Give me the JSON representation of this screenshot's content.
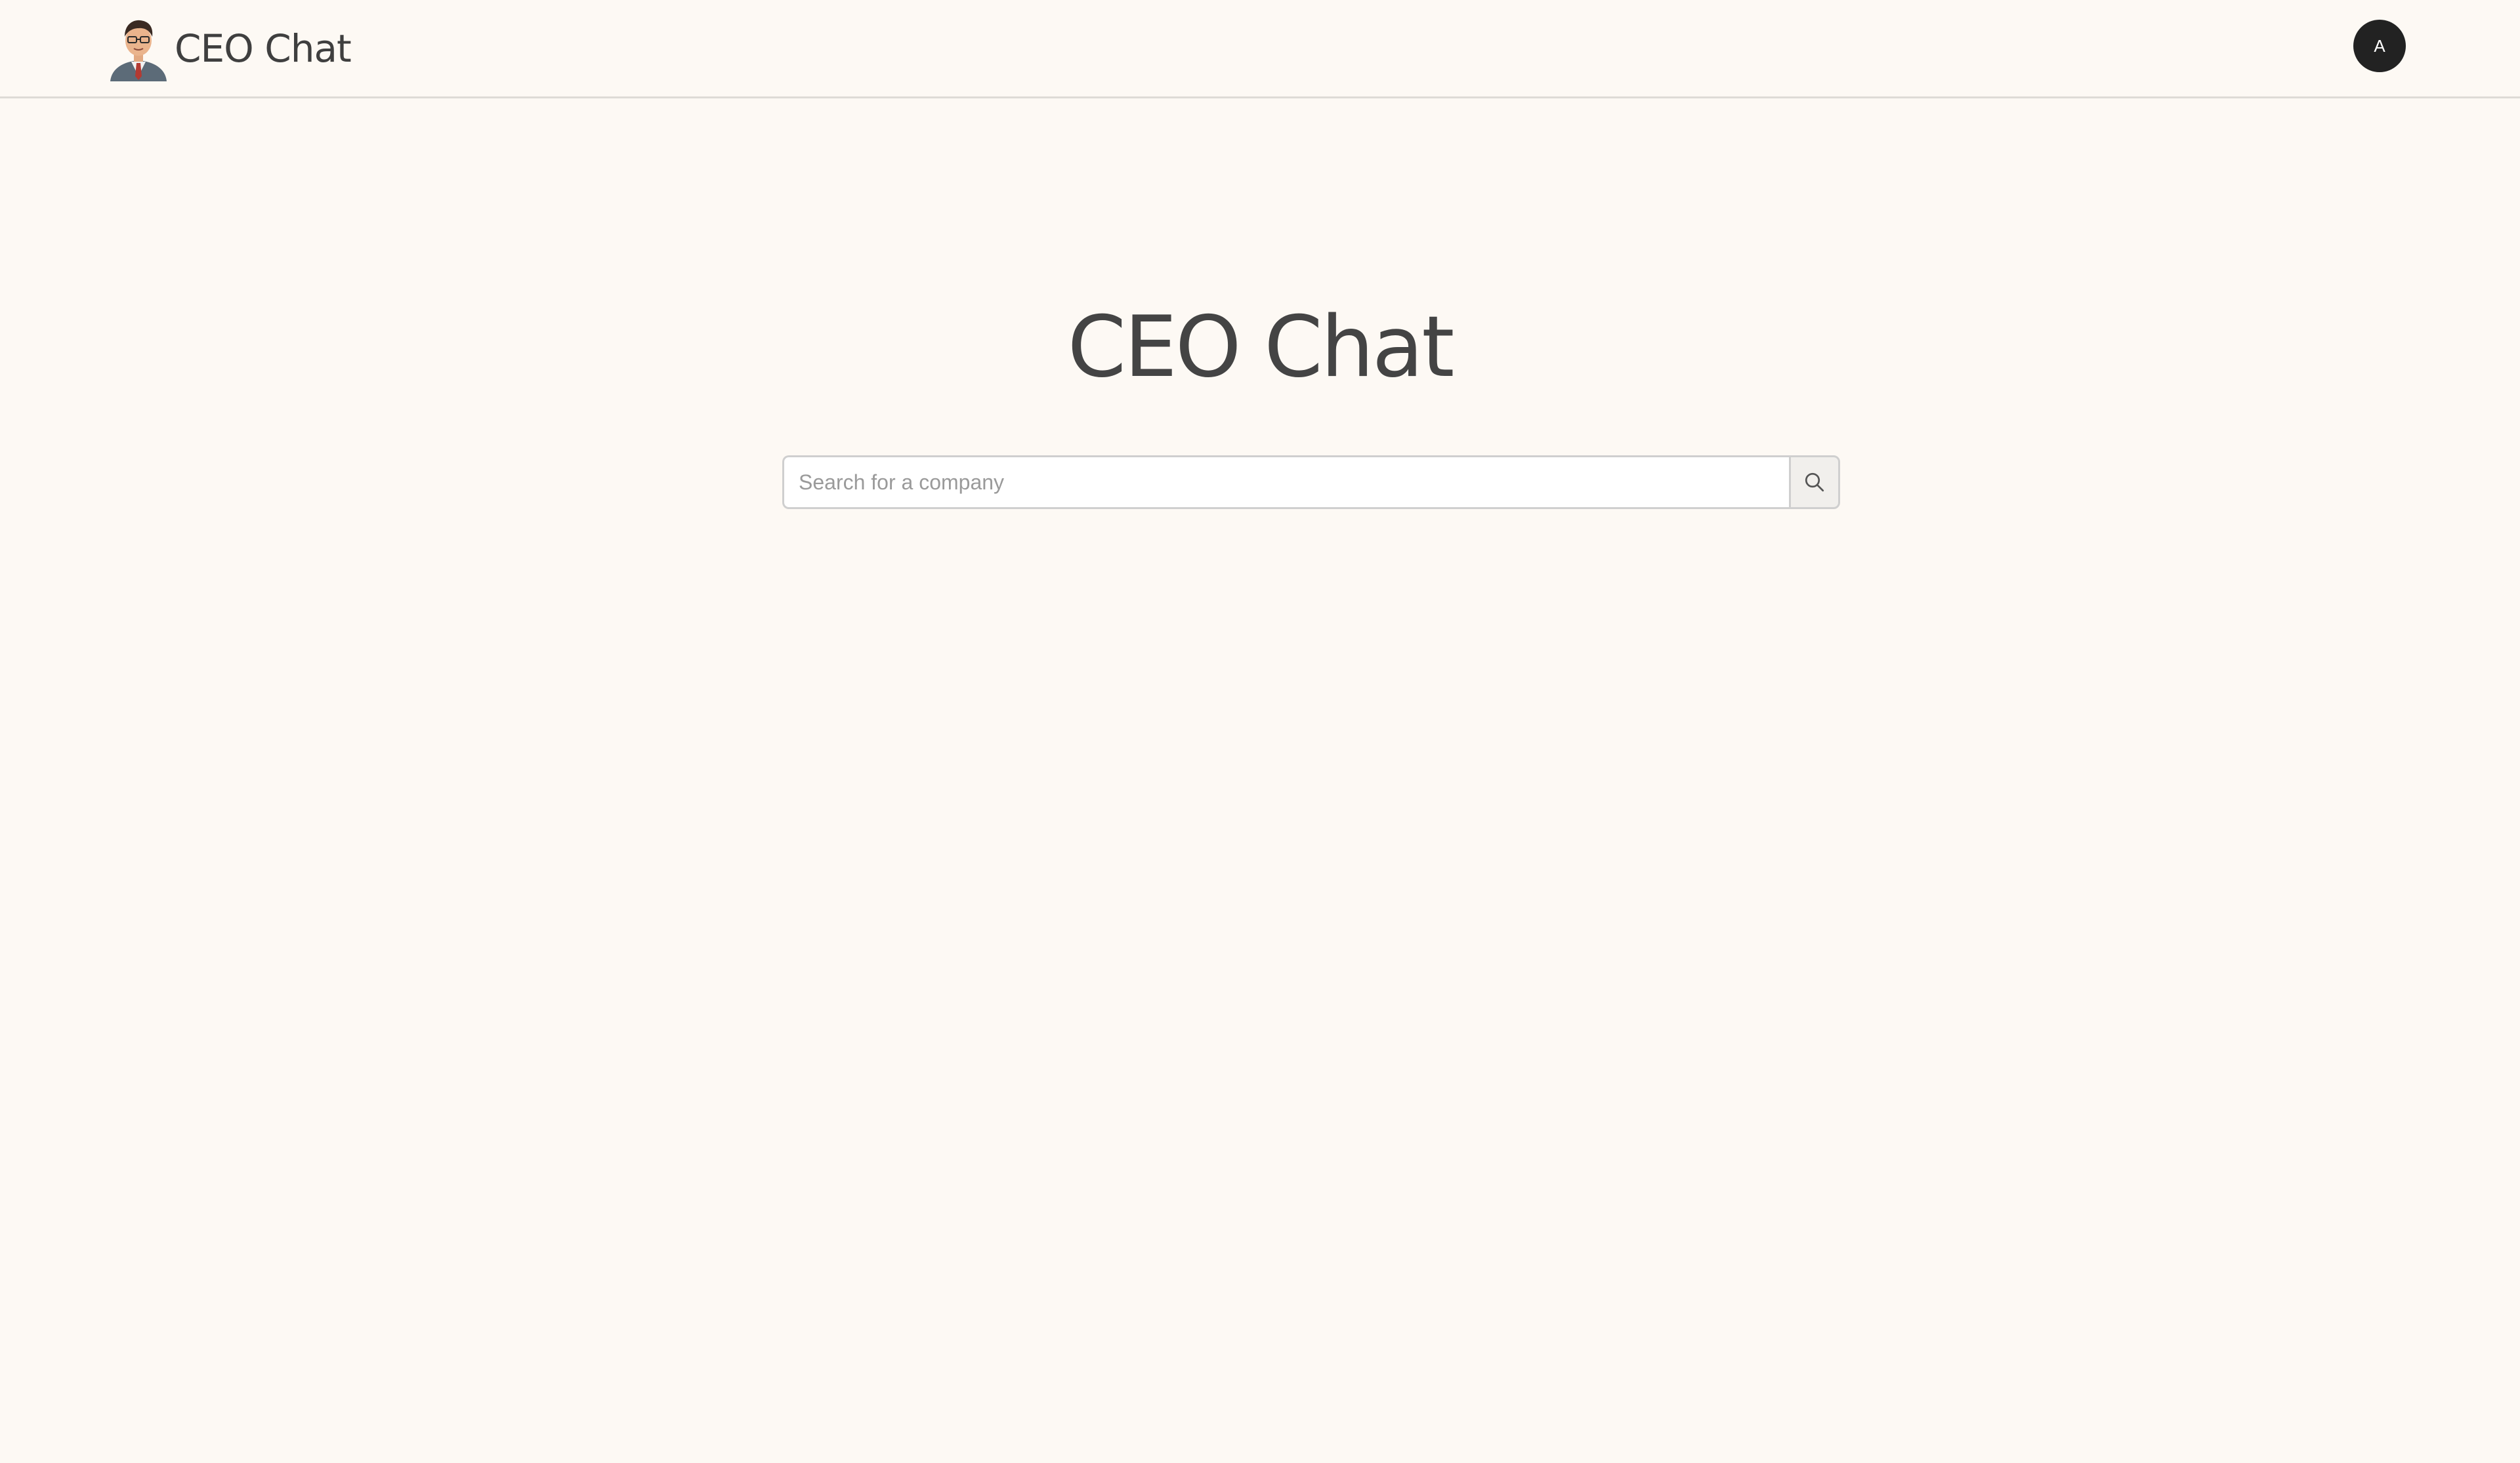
{
  "header": {
    "brand_name": "CEO Chat",
    "logo_icon": "ceo-avatar-logo",
    "user_avatar_initial": "A"
  },
  "main": {
    "title": "CEO Chat",
    "search": {
      "placeholder": "Search for a company",
      "value": "",
      "button_icon": "search-icon"
    }
  },
  "colors": {
    "background": "#fdf9f4",
    "text": "#444444",
    "avatar_bg": "#222222"
  }
}
